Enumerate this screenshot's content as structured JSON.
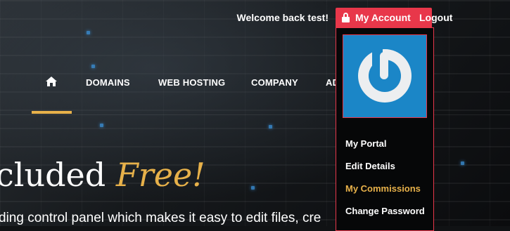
{
  "topbar": {
    "welcome_text": "Welcome back test!",
    "account_label": "My Account",
    "logout_label": "Logout"
  },
  "nav": {
    "home_icon": "home-icon",
    "items": [
      "DOMAINS",
      "WEB HOSTING",
      "COMPANY",
      "AD"
    ]
  },
  "hero": {
    "title_prefix": "cluded ",
    "title_highlight": "Free!",
    "subtitle": "ding control panel which makes it easy to edit files, cre"
  },
  "dropdown": {
    "avatar_icon": "power-icon",
    "items": [
      "My Portal",
      "Edit Details",
      "My Commissions",
      "Change Password"
    ],
    "active_item": "My Commissions"
  },
  "colors": {
    "accent_red": "#e8374a",
    "accent_gold": "#e7b14a",
    "avatar_blue": "#1b86c7"
  }
}
